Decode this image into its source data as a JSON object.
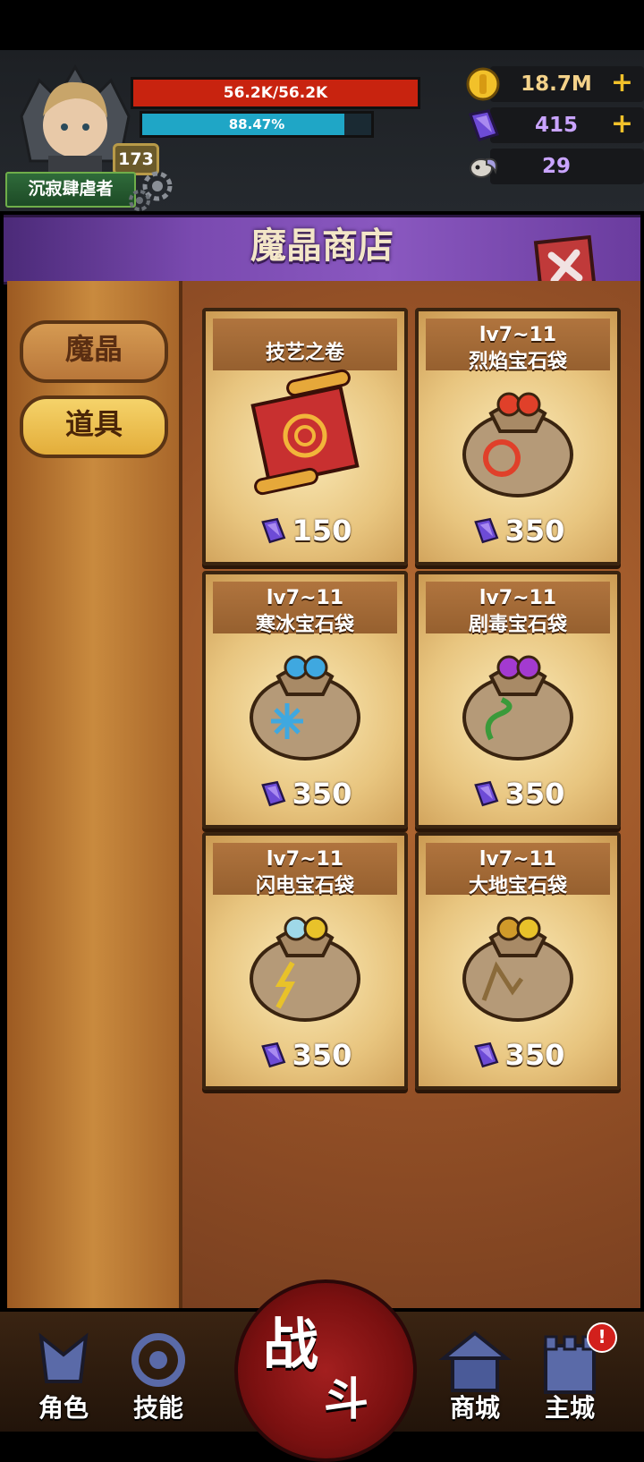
{
  "player": {
    "name": "沉寂肆虐者",
    "level": "173",
    "hp_text": "56.2K/56.2K",
    "hp_fraction": 1.0,
    "exp_text": "88.47%",
    "exp_fraction": 0.8847
  },
  "resources": {
    "gold": "18.7M",
    "crystal": "415",
    "skull": "29"
  },
  "shop": {
    "title": "魔晶商店",
    "tabs": [
      {
        "label": "魔晶",
        "selected": false
      },
      {
        "label": "道具",
        "selected": true
      }
    ],
    "items": [
      {
        "level": "",
        "name": "技艺之卷",
        "price": "150",
        "art": "scroll-icon",
        "color": "#c83030"
      },
      {
        "level": "lv7~11",
        "name": "烈焰宝石袋",
        "price": "350",
        "art": "fire-gem-bag-icon",
        "color": "#e0402a"
      },
      {
        "level": "lv7~11",
        "name": "寒冰宝石袋",
        "price": "350",
        "art": "ice-gem-bag-icon",
        "color": "#3fa8e0"
      },
      {
        "level": "lv7~11",
        "name": "剧毒宝石袋",
        "price": "350",
        "art": "poison-gem-bag-icon",
        "color": "#3a9a3a"
      },
      {
        "level": "lv7~11",
        "name": "闪电宝石袋",
        "price": "350",
        "art": "lightning-gem-bag-icon",
        "color": "#e8c22a"
      },
      {
        "level": "lv7~11",
        "name": "大地宝石袋",
        "price": "350",
        "art": "earth-gem-bag-icon",
        "color": "#d09a2a"
      }
    ]
  },
  "nav": {
    "role": "角色",
    "skill": "技能",
    "battle1": "战",
    "battle2": "斗",
    "mall": "商城",
    "city": "主城",
    "city_badge": "!"
  }
}
